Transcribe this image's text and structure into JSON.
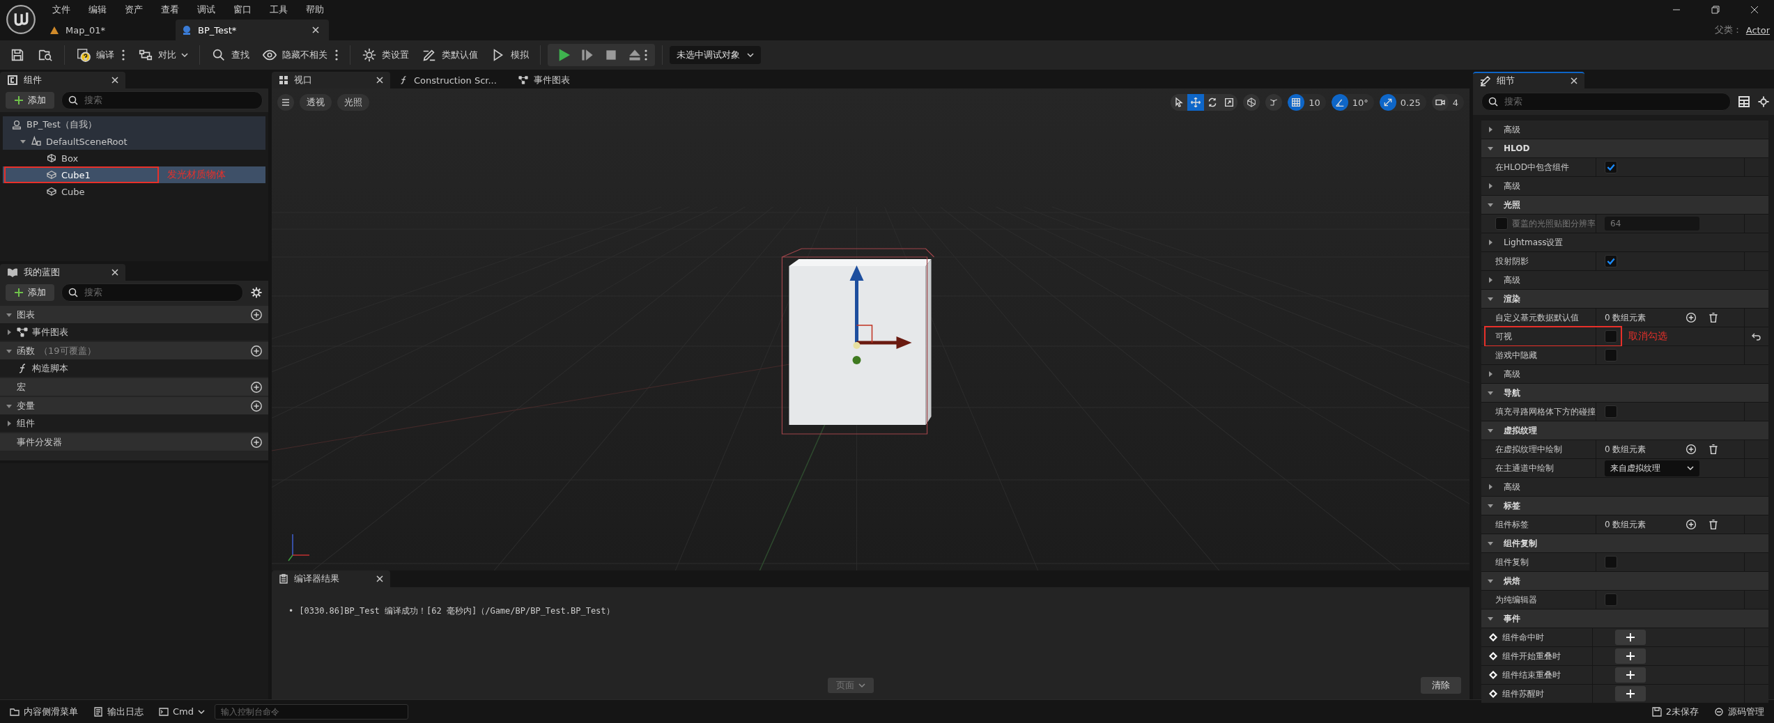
{
  "menu": [
    "文件",
    "编辑",
    "资产",
    "查看",
    "调试",
    "窗口",
    "工具",
    "帮助"
  ],
  "doc_tabs": [
    {
      "label": "Map_01*",
      "kind": "level",
      "selected": false
    },
    {
      "label": "BP_Test*",
      "kind": "blueprint",
      "selected": true
    }
  ],
  "parent_class": {
    "label": "父类：",
    "value": "Actor"
  },
  "toolbar_groups": [
    [
      {
        "kind": "save"
      },
      {
        "kind": "browse"
      }
    ],
    [
      {
        "kind": "compile",
        "label": "编译",
        "more": true
      },
      {
        "kind": "diff",
        "label": "对比",
        "caret": true
      }
    ],
    [
      {
        "kind": "find",
        "label": "查找"
      },
      {
        "kind": "hide",
        "label": "隐藏不相关",
        "more": true
      }
    ],
    [
      {
        "kind": "settings",
        "label": "类设置"
      },
      {
        "kind": "defaults",
        "label": "类默认值"
      },
      {
        "kind": "simulate",
        "label": "模拟"
      }
    ]
  ],
  "play_controls": [
    {
      "kind": "play"
    },
    {
      "kind": "step"
    },
    {
      "kind": "stop"
    },
    {
      "kind": "eject"
    }
  ],
  "debug_target": "未选中调试对象",
  "components": {
    "title": "组件",
    "selected": false,
    "add": "添加",
    "search_placeholder": "搜索",
    "tree": [
      {
        "label": "BP_Test（自我）",
        "kind": "actor",
        "selected": false,
        "children": [
          {
            "label": "DefaultSceneRoot",
            "kind": "root",
            "selected": false,
            "expanded": true,
            "children": [
              {
                "label": "Box",
                "kind": "box",
                "selected": false
              },
              {
                "label": "Cube1",
                "kind": "mesh",
                "selected": true,
                "annotation": "发光材质物体"
              },
              {
                "label": "Cube",
                "kind": "mesh",
                "selected": false
              }
            ]
          }
        ]
      }
    ]
  },
  "my_blueprint": {
    "title": "我的蓝图",
    "selected": false,
    "add": "添加",
    "search_placeholder": "搜索",
    "sections": [
      {
        "label": "图表",
        "expanded": true,
        "items": [
          {
            "label": "事件图表",
            "kind": "graph",
            "expanded": false
          }
        ]
      },
      {
        "label": "函数",
        "note": "（19可覆盖）",
        "expanded": true,
        "items": [
          {
            "label": "构造脚本",
            "kind": "function"
          }
        ]
      },
      {
        "label": "宏"
      },
      {
        "label": "变量",
        "expanded": true,
        "items": [
          {
            "label": "组件",
            "kind": "category",
            "expanded": false
          }
        ]
      },
      {
        "label": "事件分发器"
      }
    ]
  },
  "viewport": {
    "tabs": [
      {
        "label": "视口",
        "kind": "viewport",
        "selected": true
      },
      {
        "label": "Construction Scr...",
        "kind": "function",
        "selected": false
      },
      {
        "label": "事件图表",
        "kind": "graph",
        "selected": false
      }
    ],
    "view_buttons": [
      "透视",
      "光照"
    ],
    "transform_tools": [
      {
        "kind": "select",
        "on": false
      },
      {
        "kind": "move",
        "on": true
      },
      {
        "kind": "rotate",
        "on": false
      },
      {
        "kind": "scale",
        "on": false
      }
    ],
    "snaps": [
      {
        "kind": "grid",
        "value": "10",
        "on": true
      },
      {
        "kind": "angle",
        "value": "10°",
        "on": true
      },
      {
        "kind": "scale",
        "value": "0.25",
        "on": true
      },
      {
        "kind": "camera",
        "value": "4"
      }
    ]
  },
  "compiler": {
    "title": "编译器结果",
    "messages": [
      {
        "bullet": "•",
        "text": "[0330.86]BP_Test 编译成功！[62 毫秒内]（/Game/BP/BP_Test.BP_Test）"
      }
    ],
    "page": "页面",
    "clear": "清除"
  },
  "details": {
    "title": "细节",
    "selected": true,
    "search_placeholder": "搜索",
    "rows": [
      {
        "kind": "subgroup",
        "label": "高级",
        "expanded": false
      },
      {
        "kind": "section",
        "label": "HLOD",
        "expanded": true
      },
      {
        "kind": "property",
        "label": "在HLOD中包含组件",
        "value": {
          "kind": "checkbox",
          "checked": true
        }
      },
      {
        "kind": "subgroup",
        "label": "高级",
        "expanded": false
      },
      {
        "kind": "section",
        "label": "光照",
        "expanded": true
      },
      {
        "kind": "property",
        "label": "覆盖的光照贴图分辨率",
        "disabled": true,
        "override": {
          "checked": false
        },
        "value": {
          "kind": "number",
          "text": "64"
        }
      },
      {
        "kind": "subgroup",
        "label": "Lightmass设置",
        "expanded": false
      },
      {
        "kind": "property",
        "label": "投射阴影",
        "value": {
          "kind": "checkbox",
          "checked": true
        }
      },
      {
        "kind": "subgroup",
        "label": "高级",
        "expanded": false
      },
      {
        "kind": "section",
        "label": "渲染",
        "expanded": true
      },
      {
        "kind": "property",
        "label": "自定义基元数据默认值",
        "value": {
          "kind": "array",
          "text": "0 数组元素"
        }
      },
      {
        "kind": "property",
        "label": "可视",
        "resettable": true,
        "annotation": "取消勾选",
        "value": {
          "kind": "checkbox",
          "checked": false
        }
      },
      {
        "kind": "property",
        "label": "游戏中隐藏",
        "value": {
          "kind": "checkbox",
          "checked": false
        }
      },
      {
        "kind": "subgroup",
        "label": "高级",
        "expanded": false
      },
      {
        "kind": "section",
        "label": "导航",
        "expanded": true
      },
      {
        "kind": "property",
        "label": "填充寻路网格体下方的碰撞",
        "value": {
          "kind": "checkbox",
          "checked": false
        }
      },
      {
        "kind": "section",
        "label": "虚拟纹理",
        "expanded": true
      },
      {
        "kind": "property",
        "label": "在虚拟纹理中绘制",
        "value": {
          "kind": "array",
          "text": "0 数组元素"
        }
      },
      {
        "kind": "property",
        "label": "在主通道中绘制",
        "value": {
          "kind": "dropdown",
          "text": "来自虚拟纹理"
        }
      },
      {
        "kind": "subgroup",
        "label": "高级",
        "expanded": false
      },
      {
        "kind": "section",
        "label": "标签",
        "expanded": true
      },
      {
        "kind": "property",
        "label": "组件标签",
        "value": {
          "kind": "array",
          "text": "0 数组元素"
        }
      },
      {
        "kind": "section",
        "label": "组件复制",
        "expanded": true
      },
      {
        "kind": "property",
        "label": "组件复制",
        "value": {
          "kind": "checkbox",
          "checked": false
        }
      },
      {
        "kind": "section",
        "label": "烘焙",
        "expanded": true
      },
      {
        "kind": "property",
        "label": "为纯编辑器",
        "value": {
          "kind": "checkbox",
          "checked": false
        }
      },
      {
        "kind": "section",
        "label": "事件",
        "expanded": true
      },
      {
        "kind": "event",
        "label": "组件命中时"
      },
      {
        "kind": "event",
        "label": "组件开始重叠时"
      },
      {
        "kind": "event",
        "label": "组件结束重叠时"
      },
      {
        "kind": "event",
        "label": "组件苏醒时"
      }
    ]
  },
  "status_bar": {
    "left": [
      {
        "kind": "drawer",
        "label": "内容侧滑菜单"
      },
      {
        "kind": "log",
        "label": "输出日志"
      }
    ],
    "console": {
      "label": "Cmd",
      "placeholder": "输入控制台命令"
    },
    "right": [
      {
        "kind": "unsaved",
        "label": "2未保存"
      },
      {
        "kind": "source",
        "label": "源码管理"
      }
    ]
  }
}
